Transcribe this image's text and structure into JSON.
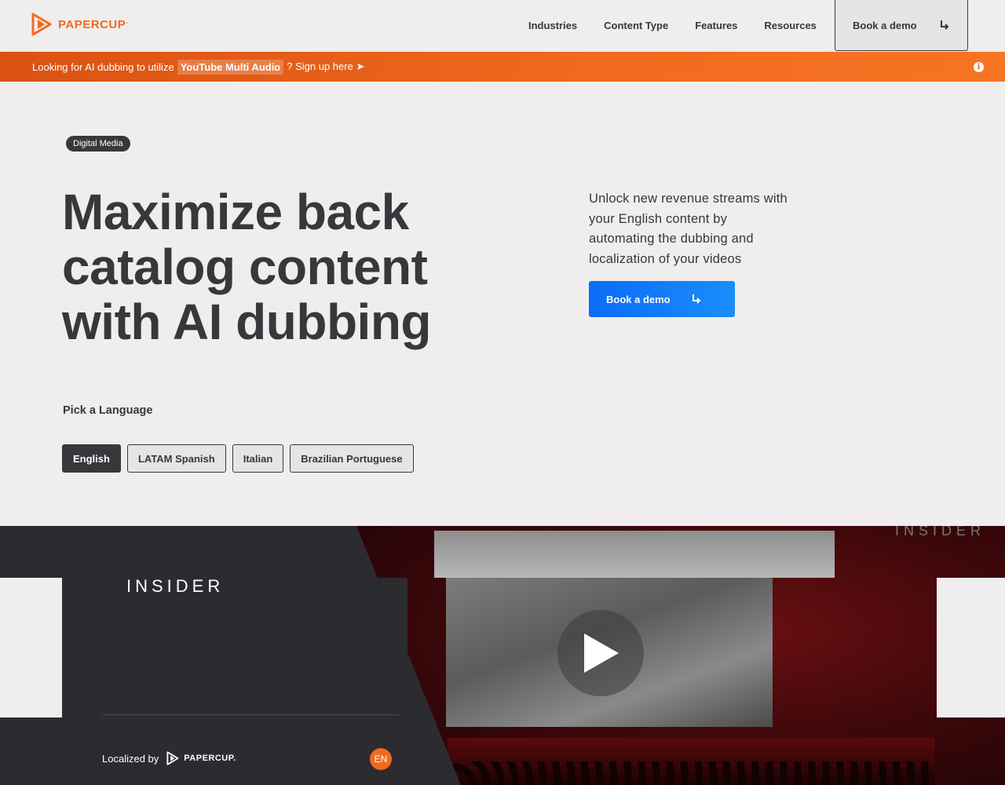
{
  "nav": {
    "logo_text": "PAPERCUP",
    "logo_sup": ".",
    "menu": [
      "Industries",
      "Content Type",
      "Features",
      "Resources"
    ],
    "demo_label": "Book a demo"
  },
  "banner": {
    "prefix": "Looking for AI dubbing to utilize",
    "highlight": "YouTube Multi Audio",
    "suffix": "? Sign up here ➤",
    "info_glyph": "i"
  },
  "hero": {
    "tag": "Digital Media",
    "headline_lines": [
      "Maximize back",
      "catalog content",
      "with AI dubbing"
    ],
    "lead": "Unlock new revenue streams with your English content by automating the dubbing and localization of your videos",
    "demo_label": "Book a demo"
  },
  "language_picker": {
    "label": "Pick a Language",
    "options": [
      "English",
      "LATAM Spanish",
      "Italian",
      "Brazilian Portuguese"
    ],
    "selected": "English"
  },
  "video": {
    "brand": "INSIDER",
    "corner_brand": "INSIDER",
    "localized_label": "Localized by",
    "localized_logo": "PAPERCUP.",
    "language_badge": "EN"
  },
  "colors": {
    "accent_orange": "#f06a1e",
    "accent_blue": "#0a6cf5",
    "dark": "#38373c"
  }
}
